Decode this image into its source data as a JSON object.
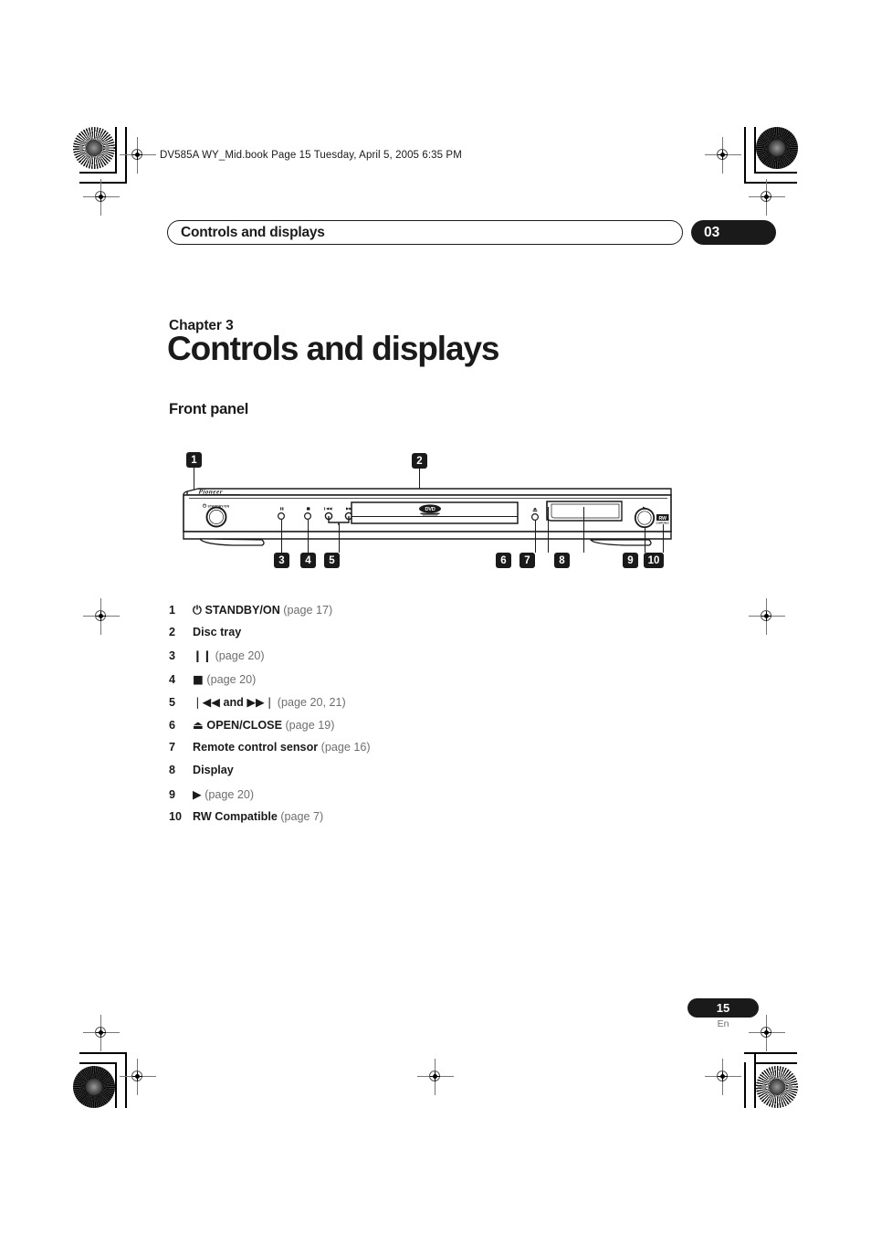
{
  "document": {
    "book_line": "DV585A WY_Mid.book  Page 15  Tuesday, April 5, 2005  6:35 PM",
    "running_header_title": "Controls and displays",
    "chapter_badge": "03",
    "chapter_label": "Chapter 3",
    "chapter_title": "Controls and displays",
    "section_title": "Front panel",
    "page_number": "15",
    "page_language": "En"
  },
  "diagram": {
    "name": "front-panel-illustration",
    "brand_logo": "Pioneer",
    "power_label": "STANDBY/ON",
    "disc_logo": "DVD",
    "rw_logo": "RW",
    "rw_sub": "COMPATIBLE",
    "callouts": [
      {
        "id": "1",
        "label": "1"
      },
      {
        "id": "2",
        "label": "2"
      },
      {
        "id": "3",
        "label": "3"
      },
      {
        "id": "4",
        "label": "4"
      },
      {
        "id": "5",
        "label": "5"
      },
      {
        "id": "6",
        "label": "6"
      },
      {
        "id": "7",
        "label": "7"
      },
      {
        "id": "8",
        "label": "8"
      },
      {
        "id": "9",
        "label": "9"
      },
      {
        "id": "10",
        "label": "10"
      }
    ]
  },
  "legend": {
    "items": [
      {
        "num": "1",
        "icon": "⏻",
        "name": "STANDBY/ON",
        "page": "(page 17)"
      },
      {
        "num": "2",
        "icon": "",
        "name": "Disc tray",
        "page": ""
      },
      {
        "num": "3",
        "icon": "❙❙",
        "name": "",
        "page": "(page 20)"
      },
      {
        "num": "4",
        "icon": "■",
        "name": "",
        "page": "(page 20)"
      },
      {
        "num": "5",
        "icon": "❘◀◀",
        "name": "and",
        "page": "(page 20, 21)",
        "icon2": "▶▶❘"
      },
      {
        "num": "6",
        "icon": "⏏",
        "name": "OPEN/CLOSE",
        "page": "(page 19)"
      },
      {
        "num": "7",
        "icon": "",
        "name": "Remote control sensor",
        "page": "(page 16)"
      },
      {
        "num": "8",
        "icon": "",
        "name": "Display",
        "page": ""
      },
      {
        "num": "9",
        "icon": "▶",
        "name": "",
        "page": "(page 20)"
      },
      {
        "num": "10",
        "icon": "",
        "name": "RW Compatible",
        "page": "(page 7)"
      }
    ]
  },
  "colors": {
    "ink": "#1a1a1a",
    "muted": "#6e6e6e",
    "paper": "#ffffff"
  }
}
